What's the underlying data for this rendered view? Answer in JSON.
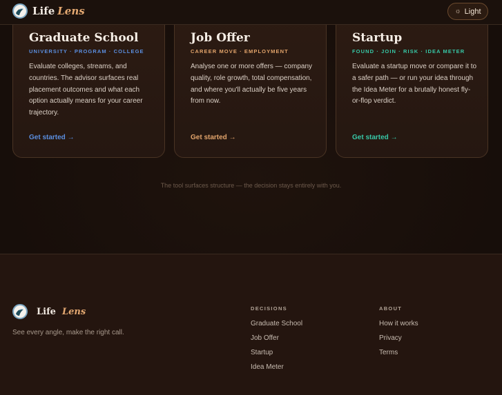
{
  "header": {
    "brand_main": "Life",
    "brand_accent": "Lens",
    "theme_label": "Light"
  },
  "cards": [
    {
      "title": "Graduate School",
      "tags": "UNIVERSITY · PROGRAM · COLLEGE",
      "description": "Evaluate colleges, streams, and countries. The advisor surfaces real placement outcomes and what each option actually means for your career trajectory.",
      "cta": "Get started →",
      "accent_color": "#5b8fe0"
    },
    {
      "title": "Job Offer",
      "tags": "CAREER MOVE · EMPLOYMENT",
      "description": "Analyse one or more offers — company quality, role growth, total compensation, and where you'll actually be five years from now.",
      "cta": "Get started →",
      "accent_color": "#e2a46b"
    },
    {
      "title": "Startup",
      "tags": "FOUND · JOIN · RISK · IDEA METER",
      "description": "Evaluate a startup move or compare it to a safer path — or run your idea through the Idea Meter for a brutally honest fly-or-flop verdict.",
      "cta": "Get started →",
      "accent_color": "#37c7a6"
    }
  ],
  "tagline": "The tool surfaces structure — the decision stays entirely with you.",
  "footer": {
    "brand_main": "Life",
    "brand_accent": "Lens",
    "tagline": "See every angle, make the right call.",
    "decisions": {
      "heading": "DECISIONS",
      "links": [
        "Graduate School",
        "Job Offer",
        "Startup",
        "Idea Meter"
      ]
    },
    "about": {
      "heading": "ABOUT",
      "links": [
        "How it works",
        "Privacy",
        "Terms"
      ]
    }
  }
}
